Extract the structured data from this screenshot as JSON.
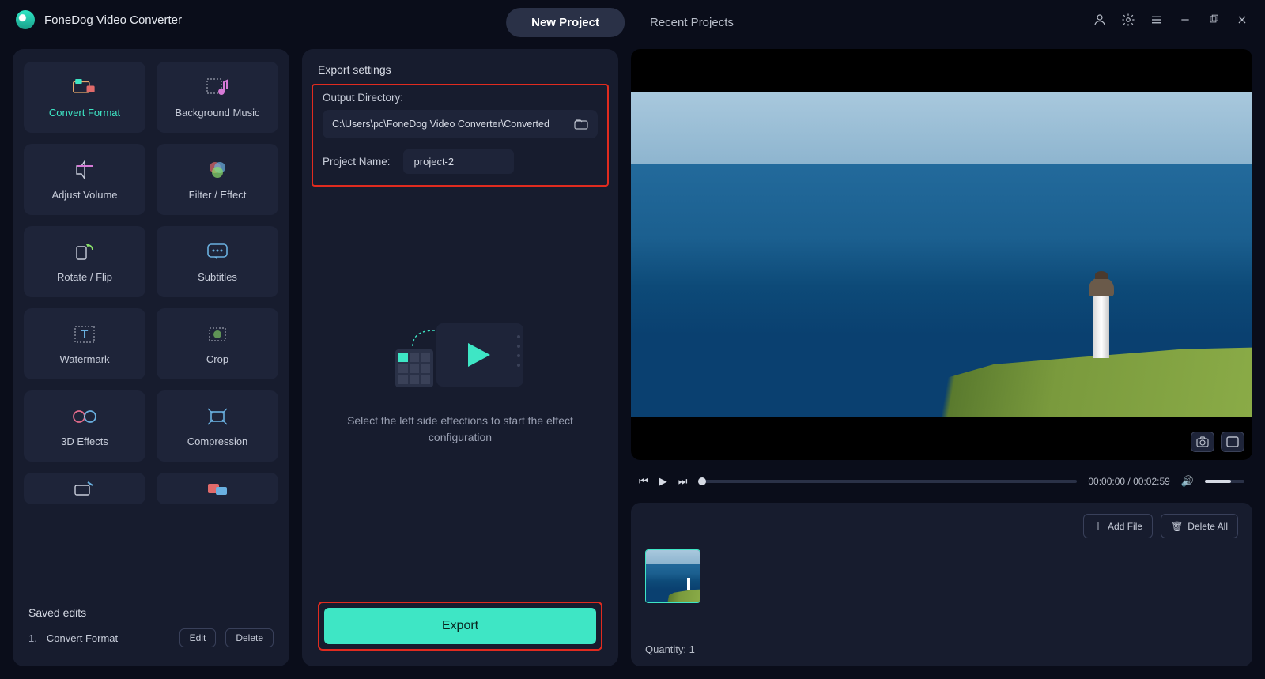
{
  "app_title": "FoneDog Video Converter",
  "tabs": {
    "new_project": "New Project",
    "recent_projects": "Recent Projects"
  },
  "tools": [
    {
      "id": "convert-format",
      "label": "Convert Format",
      "active": true
    },
    {
      "id": "background-music",
      "label": "Background Music"
    },
    {
      "id": "adjust-volume",
      "label": "Adjust Volume"
    },
    {
      "id": "filter-effect",
      "label": "Filter / Effect"
    },
    {
      "id": "rotate-flip",
      "label": "Rotate / Flip"
    },
    {
      "id": "subtitles",
      "label": "Subtitles"
    },
    {
      "id": "watermark",
      "label": "Watermark"
    },
    {
      "id": "crop",
      "label": "Crop"
    },
    {
      "id": "3d-effects",
      "label": "3D Effects"
    },
    {
      "id": "compression",
      "label": "Compression"
    }
  ],
  "saved_edits": {
    "title": "Saved edits",
    "items": [
      {
        "num": "1.",
        "name": "Convert Format"
      }
    ],
    "edit_btn": "Edit",
    "delete_btn": "Delete"
  },
  "export": {
    "section_title": "Export settings",
    "output_dir_label": "Output Directory:",
    "output_dir_value": "C:\\Users\\pc\\FoneDog Video Converter\\Converted",
    "project_name_label": "Project Name:",
    "project_name_value": "project-2",
    "placeholder_text": "Select the left side effections to start the effect configuration",
    "export_btn": "Export"
  },
  "playback": {
    "time_current": "00:00:00",
    "time_total": "00:02:59"
  },
  "files": {
    "add_file_btn": "Add File",
    "delete_all_btn": "Delete All",
    "quantity_label": "Quantity:",
    "quantity_value": "1"
  }
}
